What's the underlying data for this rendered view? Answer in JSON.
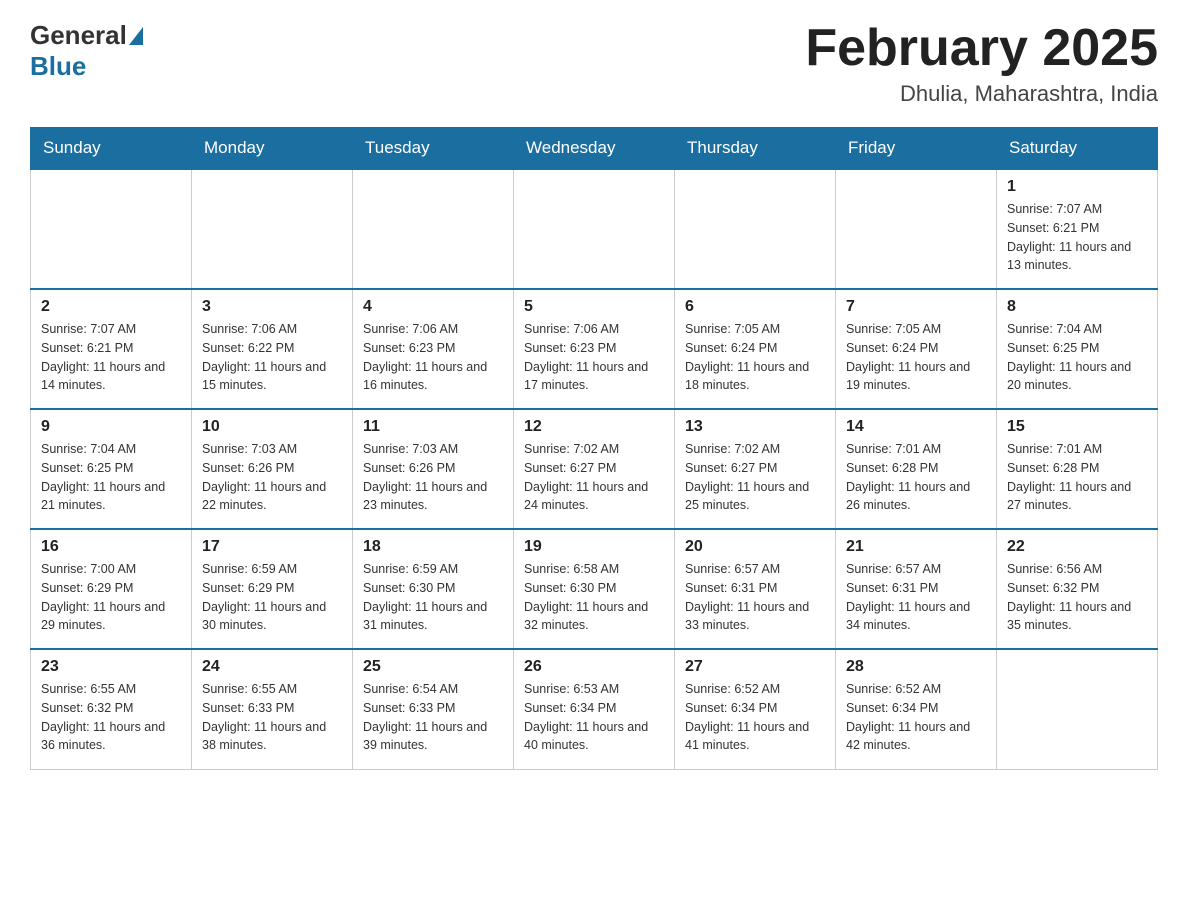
{
  "header": {
    "logo_general": "General",
    "logo_blue": "Blue",
    "month_title": "February 2025",
    "location": "Dhulia, Maharashtra, India"
  },
  "weekdays": [
    "Sunday",
    "Monday",
    "Tuesday",
    "Wednesday",
    "Thursday",
    "Friday",
    "Saturday"
  ],
  "weeks": [
    [
      {
        "day": "",
        "info": ""
      },
      {
        "day": "",
        "info": ""
      },
      {
        "day": "",
        "info": ""
      },
      {
        "day": "",
        "info": ""
      },
      {
        "day": "",
        "info": ""
      },
      {
        "day": "",
        "info": ""
      },
      {
        "day": "1",
        "info": "Sunrise: 7:07 AM\nSunset: 6:21 PM\nDaylight: 11 hours and 13 minutes."
      }
    ],
    [
      {
        "day": "2",
        "info": "Sunrise: 7:07 AM\nSunset: 6:21 PM\nDaylight: 11 hours and 14 minutes."
      },
      {
        "day": "3",
        "info": "Sunrise: 7:06 AM\nSunset: 6:22 PM\nDaylight: 11 hours and 15 minutes."
      },
      {
        "day": "4",
        "info": "Sunrise: 7:06 AM\nSunset: 6:23 PM\nDaylight: 11 hours and 16 minutes."
      },
      {
        "day": "5",
        "info": "Sunrise: 7:06 AM\nSunset: 6:23 PM\nDaylight: 11 hours and 17 minutes."
      },
      {
        "day": "6",
        "info": "Sunrise: 7:05 AM\nSunset: 6:24 PM\nDaylight: 11 hours and 18 minutes."
      },
      {
        "day": "7",
        "info": "Sunrise: 7:05 AM\nSunset: 6:24 PM\nDaylight: 11 hours and 19 minutes."
      },
      {
        "day": "8",
        "info": "Sunrise: 7:04 AM\nSunset: 6:25 PM\nDaylight: 11 hours and 20 minutes."
      }
    ],
    [
      {
        "day": "9",
        "info": "Sunrise: 7:04 AM\nSunset: 6:25 PM\nDaylight: 11 hours and 21 minutes."
      },
      {
        "day": "10",
        "info": "Sunrise: 7:03 AM\nSunset: 6:26 PM\nDaylight: 11 hours and 22 minutes."
      },
      {
        "day": "11",
        "info": "Sunrise: 7:03 AM\nSunset: 6:26 PM\nDaylight: 11 hours and 23 minutes."
      },
      {
        "day": "12",
        "info": "Sunrise: 7:02 AM\nSunset: 6:27 PM\nDaylight: 11 hours and 24 minutes."
      },
      {
        "day": "13",
        "info": "Sunrise: 7:02 AM\nSunset: 6:27 PM\nDaylight: 11 hours and 25 minutes."
      },
      {
        "day": "14",
        "info": "Sunrise: 7:01 AM\nSunset: 6:28 PM\nDaylight: 11 hours and 26 minutes."
      },
      {
        "day": "15",
        "info": "Sunrise: 7:01 AM\nSunset: 6:28 PM\nDaylight: 11 hours and 27 minutes."
      }
    ],
    [
      {
        "day": "16",
        "info": "Sunrise: 7:00 AM\nSunset: 6:29 PM\nDaylight: 11 hours and 29 minutes."
      },
      {
        "day": "17",
        "info": "Sunrise: 6:59 AM\nSunset: 6:29 PM\nDaylight: 11 hours and 30 minutes."
      },
      {
        "day": "18",
        "info": "Sunrise: 6:59 AM\nSunset: 6:30 PM\nDaylight: 11 hours and 31 minutes."
      },
      {
        "day": "19",
        "info": "Sunrise: 6:58 AM\nSunset: 6:30 PM\nDaylight: 11 hours and 32 minutes."
      },
      {
        "day": "20",
        "info": "Sunrise: 6:57 AM\nSunset: 6:31 PM\nDaylight: 11 hours and 33 minutes."
      },
      {
        "day": "21",
        "info": "Sunrise: 6:57 AM\nSunset: 6:31 PM\nDaylight: 11 hours and 34 minutes."
      },
      {
        "day": "22",
        "info": "Sunrise: 6:56 AM\nSunset: 6:32 PM\nDaylight: 11 hours and 35 minutes."
      }
    ],
    [
      {
        "day": "23",
        "info": "Sunrise: 6:55 AM\nSunset: 6:32 PM\nDaylight: 11 hours and 36 minutes."
      },
      {
        "day": "24",
        "info": "Sunrise: 6:55 AM\nSunset: 6:33 PM\nDaylight: 11 hours and 38 minutes."
      },
      {
        "day": "25",
        "info": "Sunrise: 6:54 AM\nSunset: 6:33 PM\nDaylight: 11 hours and 39 minutes."
      },
      {
        "day": "26",
        "info": "Sunrise: 6:53 AM\nSunset: 6:34 PM\nDaylight: 11 hours and 40 minutes."
      },
      {
        "day": "27",
        "info": "Sunrise: 6:52 AM\nSunset: 6:34 PM\nDaylight: 11 hours and 41 minutes."
      },
      {
        "day": "28",
        "info": "Sunrise: 6:52 AM\nSunset: 6:34 PM\nDaylight: 11 hours and 42 minutes."
      },
      {
        "day": "",
        "info": ""
      }
    ]
  ]
}
